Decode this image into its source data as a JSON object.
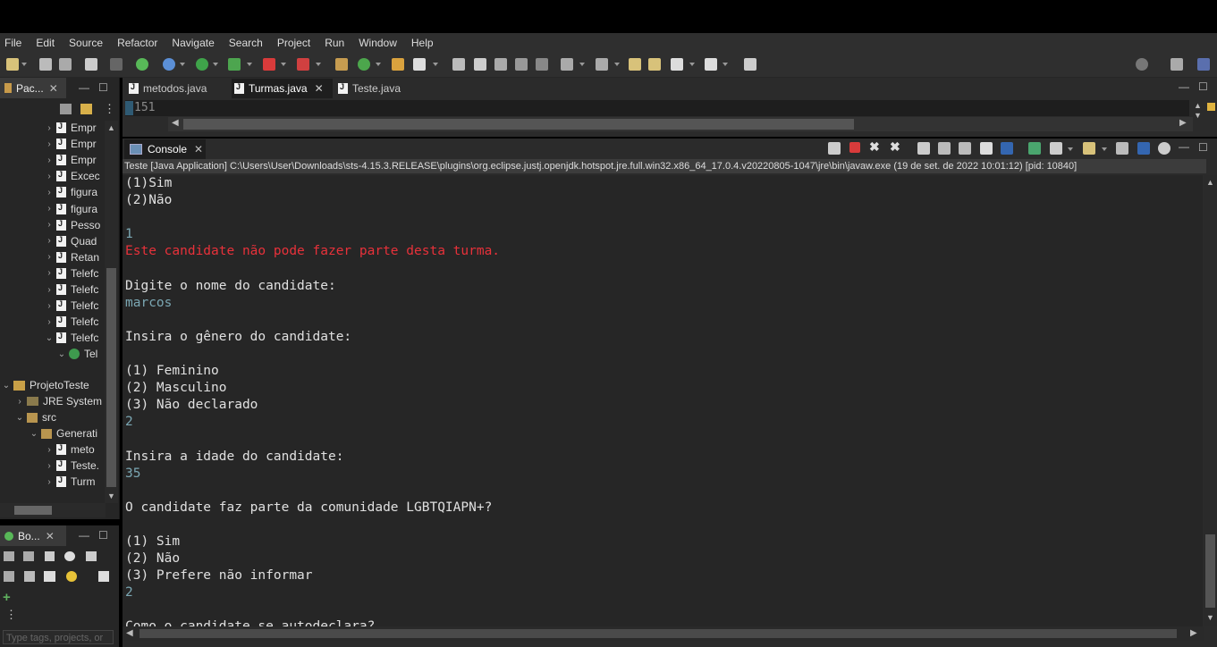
{
  "menu": [
    "File",
    "Edit",
    "Source",
    "Refactor",
    "Navigate",
    "Search",
    "Project",
    "Run",
    "Window",
    "Help"
  ],
  "package_explorer": {
    "tab_label": "Pac...",
    "items": [
      {
        "label": "Empr",
        "icon": "java-file-icon"
      },
      {
        "label": "Empr",
        "icon": "java-file-icon"
      },
      {
        "label": "Empr",
        "icon": "java-file-icon"
      },
      {
        "label": "Excec",
        "icon": "java-file-icon"
      },
      {
        "label": "figura",
        "icon": "java-file-icon"
      },
      {
        "label": "figura",
        "icon": "java-file-icon"
      },
      {
        "label": "Pesso",
        "icon": "java-file-icon"
      },
      {
        "label": "Quad",
        "icon": "java-file-icon"
      },
      {
        "label": "Retan",
        "icon": "java-file-icon"
      },
      {
        "label": "Telefc",
        "icon": "java-file-icon"
      },
      {
        "label": "Telefc",
        "icon": "java-file-icon"
      },
      {
        "label": "Telefc",
        "icon": "java-file-icon"
      },
      {
        "label": "Telefc",
        "icon": "java-file-icon"
      },
      {
        "label": "Telefc",
        "icon": "java-file-icon"
      },
      {
        "label": "Tel",
        "icon": "class-icon"
      }
    ],
    "project": "ProjetoTeste",
    "jre": "JRE System",
    "src": "src",
    "package": "Generati",
    "pkg_items": [
      "meto",
      "Teste.",
      "Turm"
    ]
  },
  "boot_dashboard": {
    "tab_label": "Bo...",
    "filter_placeholder": "Type tags, projects, or"
  },
  "editor": {
    "tabs": [
      {
        "label": "metodos.java",
        "active": false,
        "closable": false
      },
      {
        "label": "Turmas.java",
        "active": true,
        "closable": true
      },
      {
        "label": "Teste.java",
        "active": false,
        "closable": false
      }
    ],
    "line_number": "151"
  },
  "console": {
    "tab_label": "Console",
    "info": "Teste [Java Application] C:\\Users\\User\\Downloads\\sts-4.15.3.RELEASE\\plugins\\org.eclipse.justj.openjdk.hotspot.jre.full.win32.x86_64_17.0.4.v20220805-1047\\jre\\bin\\javaw.exe  (19 de set. de 2022 10:01:12) [pid: 10840]",
    "lines": [
      {
        "text": "(1)Sim",
        "type": "out"
      },
      {
        "text": "(2)Não",
        "type": "out"
      },
      {
        "text": "",
        "type": "out"
      },
      {
        "text": "1",
        "type": "inp"
      },
      {
        "text": "Este candidate não pode fazer parte desta turma.",
        "type": "err"
      },
      {
        "text": "",
        "type": "out"
      },
      {
        "text": "Digite o nome do candidate:",
        "type": "out"
      },
      {
        "text": "marcos",
        "type": "inp"
      },
      {
        "text": "",
        "type": "out"
      },
      {
        "text": "Insira o gênero do candidate:",
        "type": "out"
      },
      {
        "text": "",
        "type": "out"
      },
      {
        "text": "(1) Feminino",
        "type": "out"
      },
      {
        "text": "(2) Masculino",
        "type": "out"
      },
      {
        "text": "(3) Não declarado",
        "type": "out"
      },
      {
        "text": "2",
        "type": "inp"
      },
      {
        "text": "",
        "type": "out"
      },
      {
        "text": "Insira a idade do candidate:",
        "type": "out"
      },
      {
        "text": "35",
        "type": "inp"
      },
      {
        "text": "",
        "type": "out"
      },
      {
        "text": "O candidate faz parte da comunidade LGBTQIAPN+?",
        "type": "out"
      },
      {
        "text": "",
        "type": "out"
      },
      {
        "text": "(1) Sim",
        "type": "out"
      },
      {
        "text": "(2) Não",
        "type": "out"
      },
      {
        "text": "(3) Prefere não informar",
        "type": "out"
      },
      {
        "text": "2",
        "type": "inp"
      },
      {
        "text": "",
        "type": "out"
      },
      {
        "text": "Como o candidate se autodeclara?",
        "type": "out"
      }
    ]
  },
  "colors": {
    "error": "#e8313a",
    "input": "#7ba7b3",
    "output": "#e0e0e0",
    "background": "#262626"
  }
}
